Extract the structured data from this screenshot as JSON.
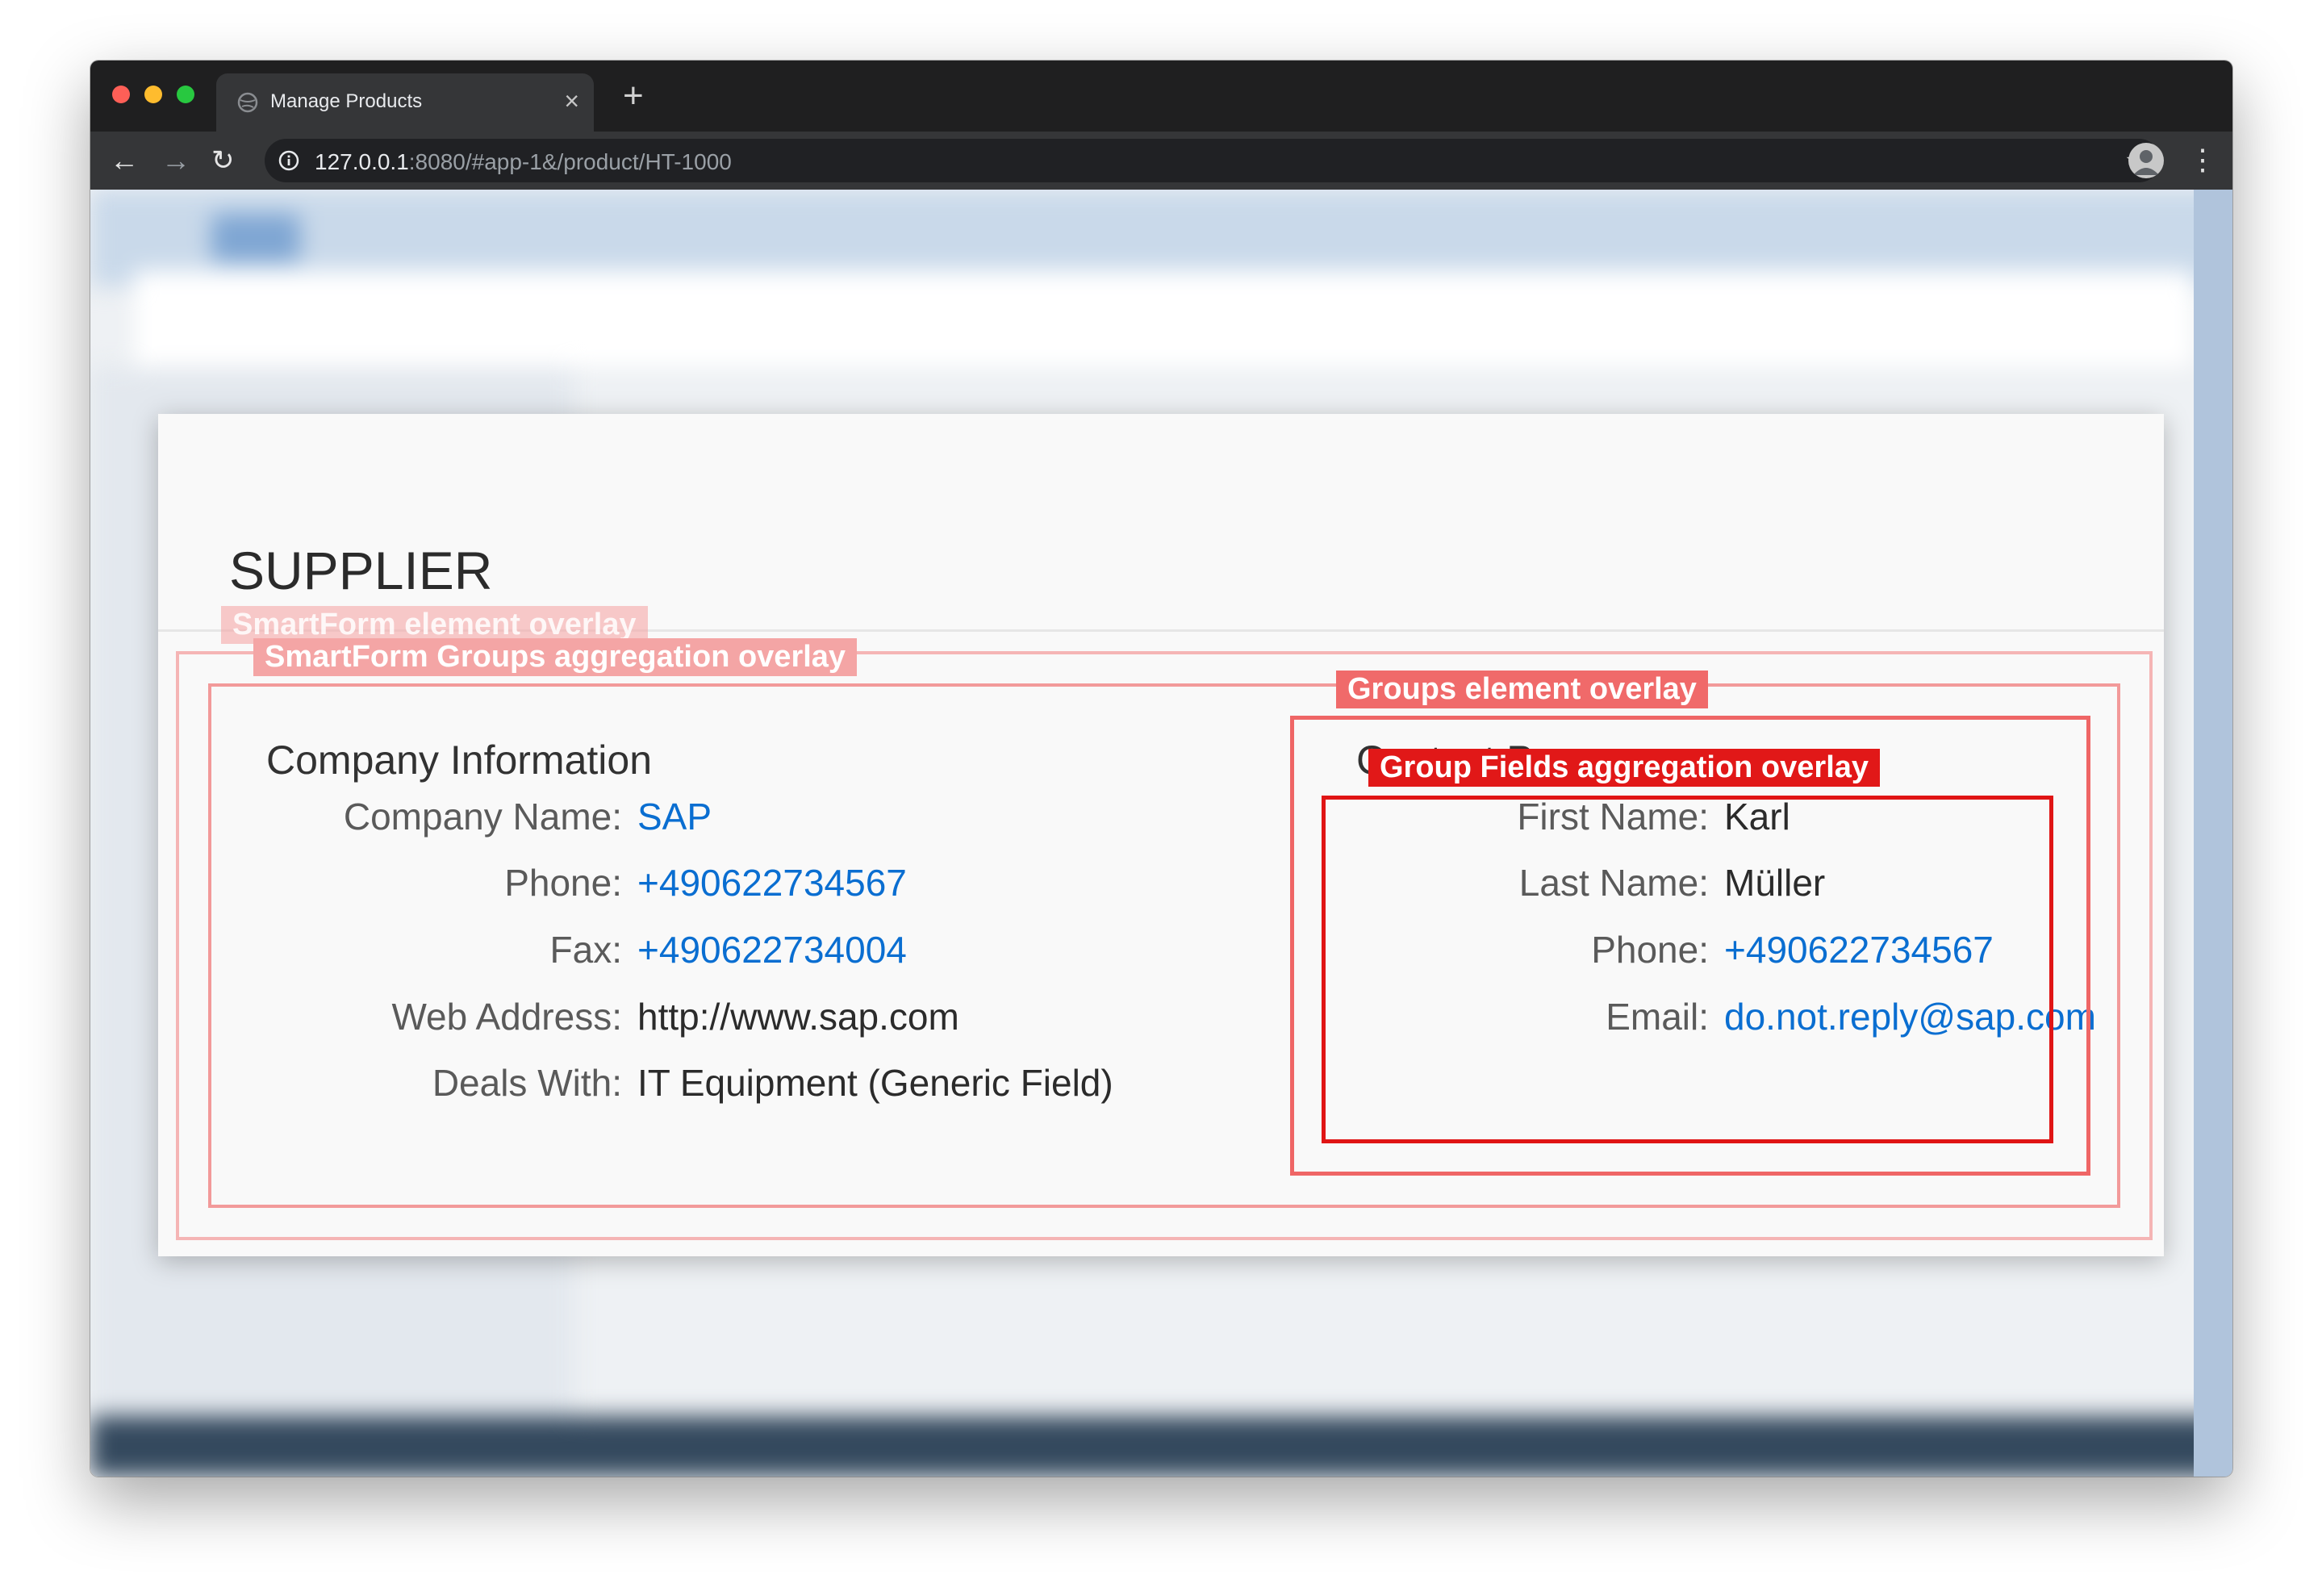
{
  "browser": {
    "tab_title": "Manage Products",
    "tab_close": "×",
    "new_tab": "+",
    "url_host": "127.0.0.1",
    "url_rest": ":8080/#app-1&/product/HT-1000",
    "back": "←",
    "forward": "→",
    "reload": "↻",
    "bookmark": "☆",
    "menu": "⋮"
  },
  "panel": {
    "title": "SUPPLIER",
    "company": {
      "title": "Company Information",
      "fields": [
        {
          "label": "Company Name:",
          "value": "SAP",
          "link": true
        },
        {
          "label": "Phone:",
          "value": "+490622734567",
          "link": true
        },
        {
          "label": "Fax:",
          "value": "+490622734004",
          "link": true
        },
        {
          "label": "Web Address:",
          "value": "http://www.sap.com",
          "link": false
        },
        {
          "label": "Deals With:",
          "value": "IT Equipment (Generic Field)",
          "link": false
        }
      ]
    },
    "contact": {
      "title": "Contact Person",
      "fields": [
        {
          "label": "First Name:",
          "value": "Karl",
          "link": false
        },
        {
          "label": "Last Name:",
          "value": "Müller",
          "link": false
        },
        {
          "label": "Phone:",
          "value": "+490622734567",
          "link": true
        },
        {
          "label": "Email:",
          "value": "do.not.reply@sap.com",
          "link": true
        }
      ]
    }
  },
  "overlays": {
    "smartform_element": "SmartForm element overlay",
    "smartform_groups": "SmartForm Groups aggregation overlay",
    "groups_element": "Groups element overlay",
    "group_fields": "Group Fields aggregation overlay"
  },
  "colors": {
    "link": "#0a6ed1",
    "overlay_light": "#f5b5b5",
    "overlay_mid": "#f29a9a",
    "overlay_strong": "#ef6666",
    "overlay_selected": "#e01515"
  }
}
